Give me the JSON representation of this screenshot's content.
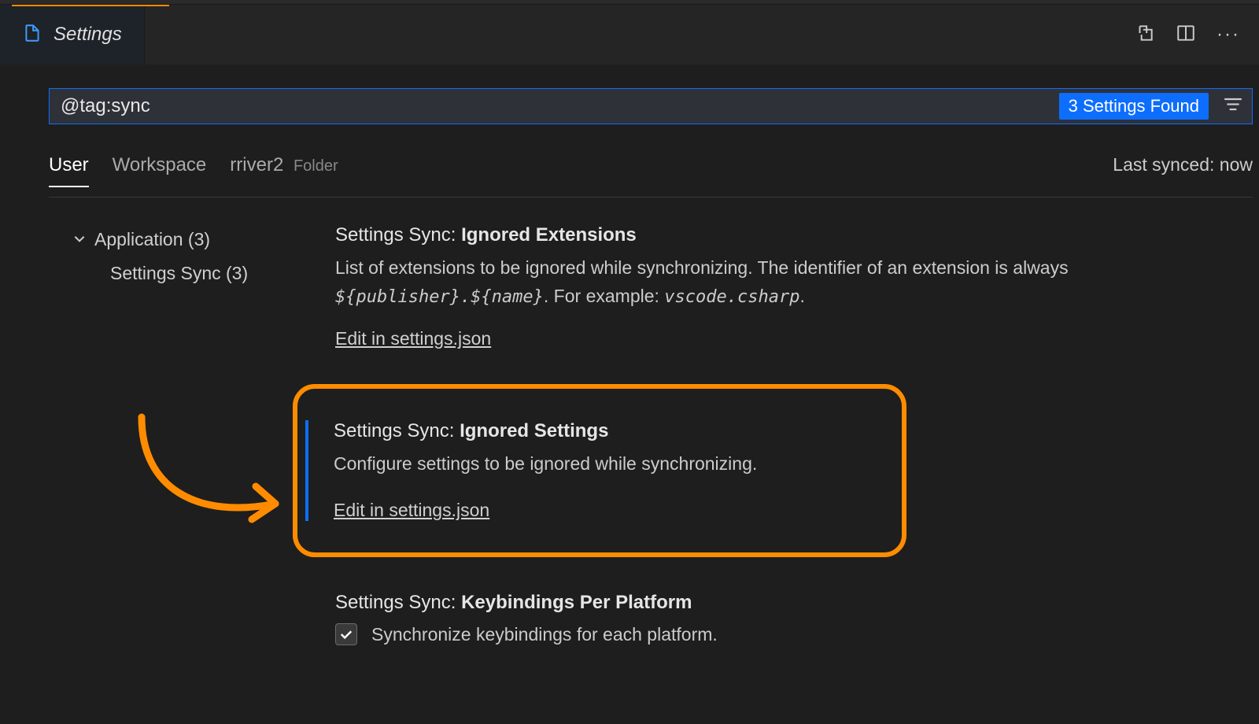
{
  "tab": {
    "label": "Settings"
  },
  "search": {
    "value": "@tag:sync",
    "results_label": "3 Settings Found"
  },
  "scopes": {
    "user": "User",
    "workspace": "Workspace",
    "folder_name": "rriver2",
    "folder_sub": "Folder"
  },
  "last_synced": "Last synced: now",
  "tree": {
    "application": "Application (3)",
    "settings_sync": "Settings Sync (3)"
  },
  "settings": {
    "ignored_ext": {
      "prefix": "Settings Sync: ",
      "name": "Ignored Extensions",
      "desc_a": "List of extensions to be ignored while synchronizing. The identifier of an extension is always ",
      "mono1": "${publisher}.${name}",
      "desc_b": ". For example: ",
      "mono2": "vscode.csharp",
      "desc_c": ".",
      "link": "Edit in settings.json"
    },
    "ignored_set": {
      "prefix": "Settings Sync: ",
      "name": "Ignored Settings",
      "desc": "Configure settings to be ignored while synchronizing.",
      "link": "Edit in settings.json"
    },
    "keybindings": {
      "prefix": "Settings Sync: ",
      "name": "Keybindings Per Platform",
      "checkbox_label": "Synchronize keybindings for each platform."
    }
  }
}
